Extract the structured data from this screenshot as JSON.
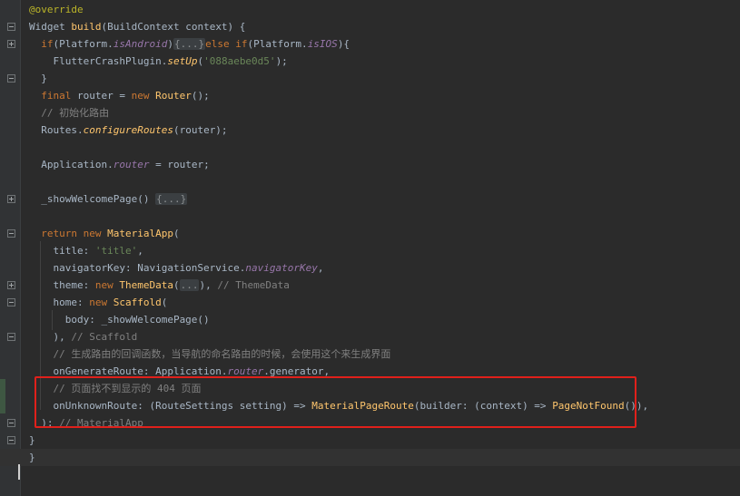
{
  "editor": {
    "lines": [
      {
        "parts": [
          {
            "t": "@override",
            "c": "ann"
          }
        ]
      },
      {
        "parts": [
          {
            "t": "Widget ",
            "c": ""
          },
          {
            "t": "build",
            "c": "fn"
          },
          {
            "t": "(BuildContext context) {",
            "c": ""
          }
        ]
      },
      {
        "parts": [
          {
            "t": "  ",
            "c": ""
          },
          {
            "t": "if",
            "c": "kw"
          },
          {
            "t": "(Platform.",
            "c": ""
          },
          {
            "t": "isAndroid",
            "c": "field"
          },
          {
            "t": ")",
            "c": ""
          },
          {
            "t": "{...}",
            "c": "folded"
          },
          {
            "t": "else if",
            "c": "kw"
          },
          {
            "t": "(Platform.",
            "c": ""
          },
          {
            "t": "isIOS",
            "c": "field"
          },
          {
            "t": "){",
            "c": ""
          }
        ]
      },
      {
        "parts": [
          {
            "t": "    FlutterCrashPlugin.",
            "c": ""
          },
          {
            "t": "setUp",
            "c": "static"
          },
          {
            "t": "(",
            "c": ""
          },
          {
            "t": "'088aebe0d5'",
            "c": "str"
          },
          {
            "t": ");",
            "c": ""
          }
        ]
      },
      {
        "parts": [
          {
            "t": "  }",
            "c": ""
          }
        ]
      },
      {
        "parts": [
          {
            "t": "  ",
            "c": ""
          },
          {
            "t": "final",
            "c": "kw"
          },
          {
            "t": " router = ",
            "c": ""
          },
          {
            "t": "new",
            "c": "kw"
          },
          {
            "t": " ",
            "c": ""
          },
          {
            "t": "Router",
            "c": "fn"
          },
          {
            "t": "();",
            "c": ""
          }
        ]
      },
      {
        "parts": [
          {
            "t": "  // 初始化路由",
            "c": "cm"
          }
        ]
      },
      {
        "parts": [
          {
            "t": "  Routes.",
            "c": ""
          },
          {
            "t": "configureRoutes",
            "c": "static"
          },
          {
            "t": "(router);",
            "c": ""
          }
        ]
      },
      {
        "parts": []
      },
      {
        "parts": [
          {
            "t": "  Application.",
            "c": ""
          },
          {
            "t": "router",
            "c": "field"
          },
          {
            "t": " = router;",
            "c": ""
          }
        ]
      },
      {
        "parts": []
      },
      {
        "parts": [
          {
            "t": "  _showWelcomePage() ",
            "c": ""
          },
          {
            "t": "{...}",
            "c": "folded"
          }
        ]
      },
      {
        "parts": []
      },
      {
        "parts": [
          {
            "t": "  ",
            "c": ""
          },
          {
            "t": "return",
            "c": "kw"
          },
          {
            "t": " ",
            "c": ""
          },
          {
            "t": "new",
            "c": "kw"
          },
          {
            "t": " ",
            "c": ""
          },
          {
            "t": "MaterialApp",
            "c": "fn"
          },
          {
            "t": "(",
            "c": ""
          }
        ]
      },
      {
        "parts": [
          {
            "t": "    title: ",
            "c": ""
          },
          {
            "t": "'title'",
            "c": "str"
          },
          {
            "t": ",",
            "c": ""
          }
        ]
      },
      {
        "parts": [
          {
            "t": "    navigatorKey: NavigationService.",
            "c": ""
          },
          {
            "t": "navigatorKey",
            "c": "field"
          },
          {
            "t": ",",
            "c": ""
          }
        ]
      },
      {
        "parts": [
          {
            "t": "    theme: ",
            "c": ""
          },
          {
            "t": "new",
            "c": "kw"
          },
          {
            "t": " ",
            "c": ""
          },
          {
            "t": "ThemeData",
            "c": "fn"
          },
          {
            "t": "(",
            "c": ""
          },
          {
            "t": "...",
            "c": "folded"
          },
          {
            "t": "), ",
            "c": ""
          },
          {
            "t": "// ThemeData",
            "c": "cm"
          }
        ]
      },
      {
        "parts": [
          {
            "t": "    home: ",
            "c": ""
          },
          {
            "t": "new",
            "c": "kw"
          },
          {
            "t": " ",
            "c": ""
          },
          {
            "t": "Scaffold",
            "c": "fn"
          },
          {
            "t": "(",
            "c": ""
          }
        ]
      },
      {
        "parts": [
          {
            "t": "      body: _showWelcomePage()",
            "c": ""
          }
        ]
      },
      {
        "parts": [
          {
            "t": "    ), ",
            "c": ""
          },
          {
            "t": "// Scaffold",
            "c": "cm"
          }
        ]
      },
      {
        "parts": [
          {
            "t": "    // 生成路由的回调函数，当导航的命名路由的时候，会使用这个来生成界面",
            "c": "cm"
          }
        ]
      },
      {
        "parts": [
          {
            "t": "    onGenerateRoute: Application.",
            "c": ""
          },
          {
            "t": "router",
            "c": "field"
          },
          {
            "t": ".generator,",
            "c": ""
          }
        ]
      },
      {
        "parts": [
          {
            "t": "    // 页面找不到显示的 404 页面",
            "c": "cm"
          }
        ]
      },
      {
        "parts": [
          {
            "t": "    onUnknownRoute: (RouteSettings setting) => ",
            "c": ""
          },
          {
            "t": "MaterialPageRoute",
            "c": "fn"
          },
          {
            "t": "(builder: (context) => ",
            "c": ""
          },
          {
            "t": "PageNotFound",
            "c": "fn"
          },
          {
            "t": "()),",
            "c": ""
          }
        ]
      },
      {
        "parts": [
          {
            "t": "  ); ",
            "c": ""
          },
          {
            "t": "// MaterialApp",
            "c": "cm"
          }
        ]
      },
      {
        "parts": [
          {
            "t": "}",
            "c": ""
          }
        ]
      },
      {
        "parts": [
          {
            "t": "}",
            "c": ""
          }
        ]
      }
    ]
  },
  "colors": {
    "background": "#2b2b2b",
    "keyword": "#cc7832",
    "annotation": "#bbb529",
    "function": "#ffc66d",
    "string": "#6a8759",
    "comment": "#808080",
    "field": "#9876aa",
    "highlight_box": "#e0201b"
  },
  "gutter": {
    "fold_markers": [
      {
        "line": 1,
        "kind": "end-open"
      },
      {
        "line": 2,
        "kind": "plus"
      },
      {
        "line": 4,
        "kind": "end"
      },
      {
        "line": 11,
        "kind": "plus"
      },
      {
        "line": 13,
        "kind": "open"
      },
      {
        "line": 16,
        "kind": "plus"
      },
      {
        "line": 17,
        "kind": "open"
      },
      {
        "line": 19,
        "kind": "end"
      },
      {
        "line": 24,
        "kind": "end"
      },
      {
        "line": 25,
        "kind": "end"
      }
    ]
  }
}
